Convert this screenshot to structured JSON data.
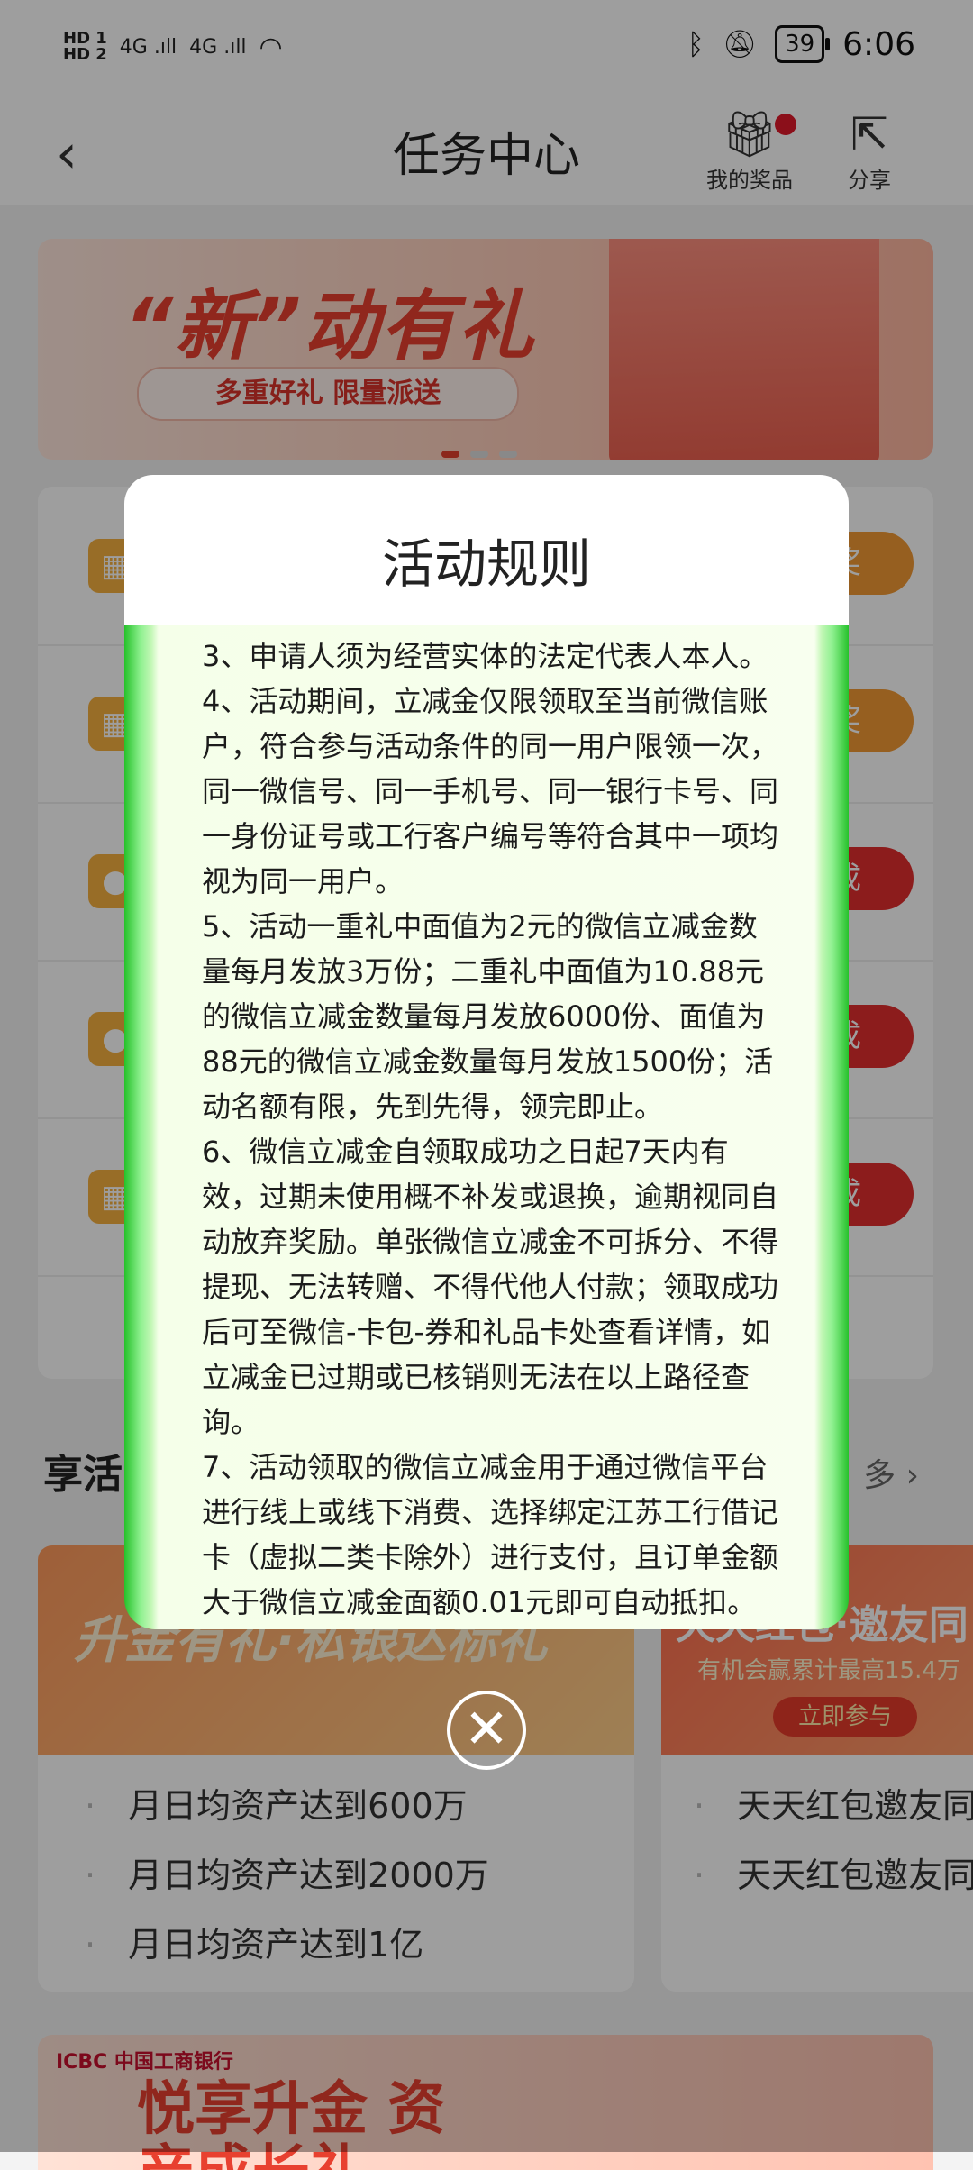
{
  "status": {
    "hd1": "HD 1",
    "hd2": "HD 2",
    "sig1": "4G .ıll",
    "sig2": "4G .ıll",
    "battery": "39",
    "time": "6:06"
  },
  "header": {
    "title": "任务中心",
    "prizes_label": "我的奖品",
    "share_label": "分享"
  },
  "banner": {
    "title": "“新”动有礼",
    "subtitle": "多重好礼 限量派送"
  },
  "tasks": [
    {
      "button": "奖",
      "color": "orange"
    },
    {
      "button": "奖",
      "color": "orange"
    },
    {
      "button": "成",
      "color": "red"
    },
    {
      "button": "成",
      "color": "red"
    },
    {
      "button": "成",
      "color": "red"
    }
  ],
  "section": {
    "title": "享活",
    "more": "多 ›"
  },
  "left_card": {
    "banner_text": "升金有礼·私银达标礼",
    "items": [
      "月日均资产达到600万",
      "月日均资产达到2000万",
      "月日均资产达到1亿"
    ]
  },
  "right_card": {
    "banner_title": "天天红包·邀友同",
    "banner_sub": "有机会赢累计最高15.4万",
    "banner_btn": "立即参与",
    "items": [
      "天天红包邀友同",
      "天天红包邀友同"
    ]
  },
  "bottom_banner": {
    "brand": "ICBC 中国工商银行",
    "title": "悦享升金 资产成长礼"
  },
  "modal": {
    "title": "活动规则",
    "rules": [
      "3、申请人须为经营实体的法定代表人本人。",
      "4、活动期间，立减金仅限领取至当前微信账户，符合参与活动条件的同一用户限领一次，同一微信号、同一手机号、同一银行卡号、同一身份证号或工行客户编号等符合其中一项均视为同一用户。",
      "5、活动一重礼中面值为2元的微信立减金数量每月发放3万份；二重礼中面值为10.88元的微信立减金数量每月发放6000份、面值为88元的微信立减金数量每月发放1500份；活动名额有限，先到先得，领完即止。",
      "6、微信立减金自领取成功之日起7天内有效，过期未使用概不补发或退换，逾期视同自动放弃奖励。单张微信立减金不可拆分、不得提现、无法转赠、不得代他人付款；领取成功后可至微信-卡包-券和礼品卡处查看详情，如立减金已过期或已核销则无法在以上路径查询。",
      "7、活动领取的微信立减金用于通过微信平台进行线上或线下消费、选择绑定江苏工行借记卡（虚拟二类卡除外）进行支付，且订单金额大于微信立减金面额0.01元即可自动抵扣。立减金可在中国境内商户使用微信支付时使用，少数特定商户"
    ],
    "close_icon": "✕"
  }
}
